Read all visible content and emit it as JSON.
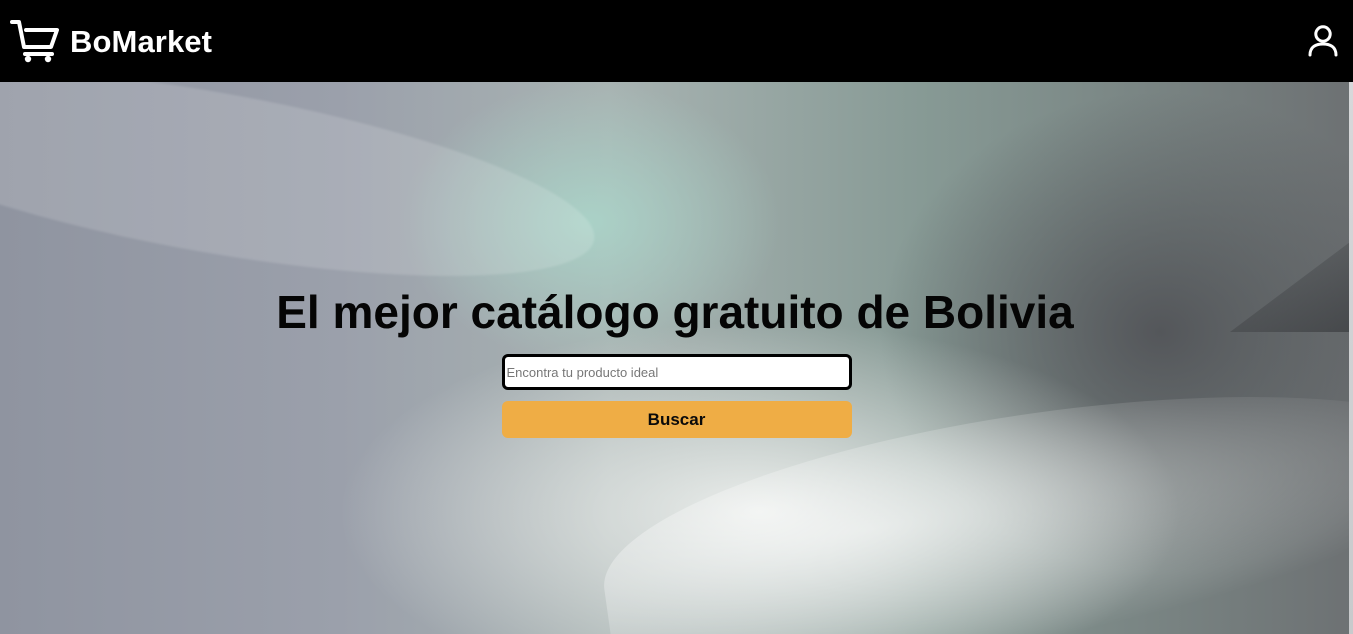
{
  "navbar": {
    "brand": "BoMarket",
    "brand_icon": "shopping-cart-icon",
    "user_icon": "user-icon",
    "background_color": "#000000",
    "text_color": "#ffffff"
  },
  "hero": {
    "title": "El mejor catálogo gratuito de Bolivia",
    "search": {
      "placeholder": "Encontra tu producto ideal",
      "value": ""
    },
    "search_button": {
      "label": "Buscar",
      "color": "#efad45"
    }
  }
}
